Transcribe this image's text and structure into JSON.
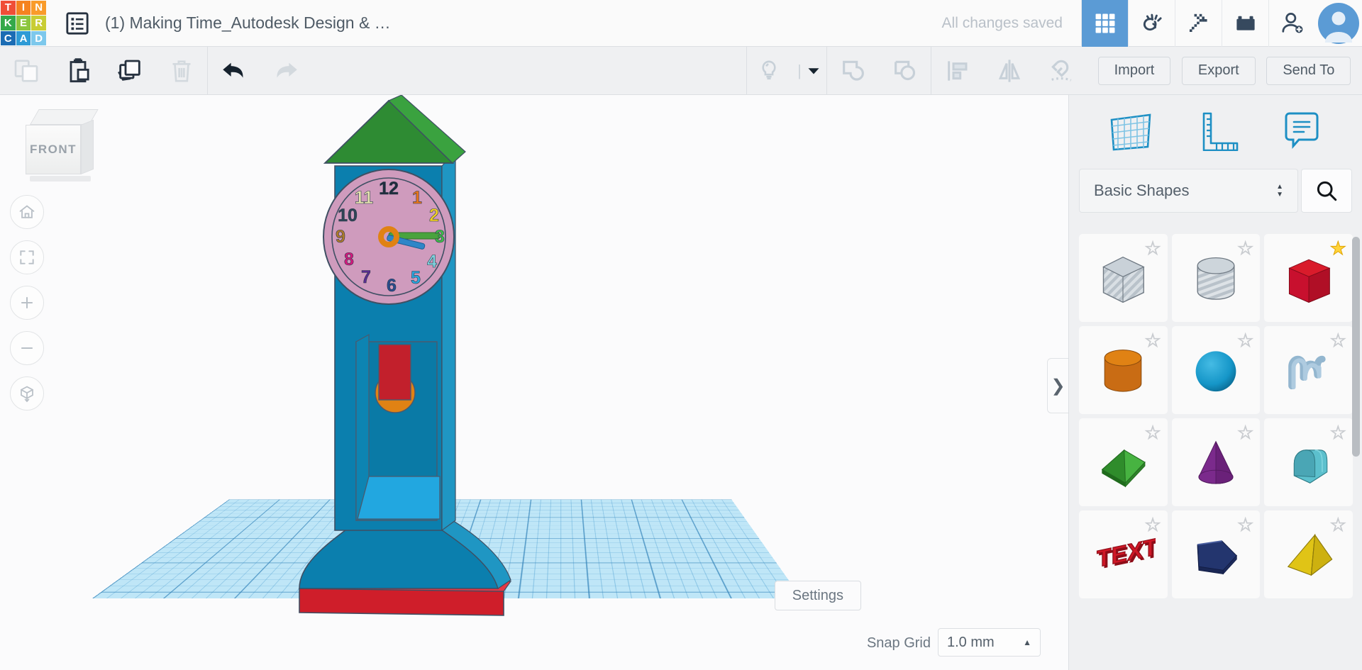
{
  "app": {
    "logo_tiles": [
      {
        "letter": "T",
        "color": "#f04e37"
      },
      {
        "letter": "I",
        "color": "#f58220"
      },
      {
        "letter": "N",
        "color": "#f99b2a"
      },
      {
        "letter": "K",
        "color": "#34a94a"
      },
      {
        "letter": "E",
        "color": "#8cc63e"
      },
      {
        "letter": "R",
        "color": "#c8cd34"
      },
      {
        "letter": "C",
        "color": "#1b6cb4"
      },
      {
        "letter": "A",
        "color": "#2e9bd6"
      },
      {
        "letter": "D",
        "color": "#7dc8ec"
      }
    ]
  },
  "header": {
    "panel_toggle_icon": "list-panel-icon",
    "title": "(1) Making Time_Autodesk Design & …",
    "save_status": "All changes saved",
    "icons": [
      {
        "name": "blocks-grid-icon",
        "active": true
      },
      {
        "name": "tinker-hand-icon",
        "active": false
      },
      {
        "name": "pickaxe-minecraft-icon",
        "active": false
      },
      {
        "name": "lego-brick-icon",
        "active": false
      },
      {
        "name": "add-person-icon",
        "active": false
      }
    ],
    "avatar_icon": "user-avatar"
  },
  "toolbar": {
    "left_tools": [
      {
        "name": "copy-button",
        "enabled": false
      },
      {
        "name": "paste-button",
        "enabled": true
      },
      {
        "name": "duplicate-button",
        "enabled": true
      },
      {
        "name": "delete-button",
        "enabled": false
      },
      {
        "name": "undo-button",
        "enabled": true
      },
      {
        "name": "redo-button",
        "enabled": false
      }
    ],
    "mid_tools": [
      {
        "name": "light-bulb-button",
        "enabled": false
      },
      {
        "name": "light-dropdown-caret",
        "enabled": true
      },
      {
        "name": "group-button",
        "enabled": false
      },
      {
        "name": "ungroup-button",
        "enabled": false
      },
      {
        "name": "align-button",
        "enabled": false
      },
      {
        "name": "mirror-button",
        "enabled": false
      },
      {
        "name": "workplane-magnet-button",
        "enabled": false
      }
    ],
    "import_label": "Import",
    "export_label": "Export",
    "send_to_label": "Send To"
  },
  "canvas": {
    "view_cube_label": "FRONT",
    "view_buttons": [
      {
        "name": "home-view-button",
        "icon": "home-icon"
      },
      {
        "name": "fit-view-button",
        "icon": "fit-frame-icon"
      },
      {
        "name": "zoom-in-button",
        "icon": "plus-icon"
      },
      {
        "name": "zoom-out-button",
        "icon": "minus-icon"
      },
      {
        "name": "perspective-toggle-button",
        "icon": "ortho-cube-icon"
      }
    ],
    "settings_label": "Settings",
    "snap_grid_label": "Snap Grid",
    "snap_grid_value": "1.0 mm",
    "grid_color": "#bfe6f7",
    "grid_line_color": "#2d7db4"
  },
  "model": {
    "name": "clock-tower-model",
    "roof_color": "#2e8b33",
    "body_color": "#0b7fae",
    "base_stripe_color": "#cf1e2a",
    "clock_face_color": "#cf9bbd",
    "clock_rim_color": "#c08fb0",
    "minute_hand_color": "#49a33e",
    "hour_hand_color": "#2e86c8",
    "hand_hub_color": "#e08214",
    "pendulum_rod_color": "#c2202c",
    "pendulum_bob_color": "#e08214",
    "cavity_floor_color": "#22a7e0",
    "clock_numerals": [
      {
        "n": "12",
        "color": "#1f2d3d"
      },
      {
        "n": "1",
        "color": "#e8751a"
      },
      {
        "n": "2",
        "color": "#f2d024"
      },
      {
        "n": "3",
        "color": "#3fbf4a"
      },
      {
        "n": "4",
        "color": "#7fd4df"
      },
      {
        "n": "5",
        "color": "#29a8e0"
      },
      {
        "n": "6",
        "color": "#2a4b8d"
      },
      {
        "n": "7",
        "color": "#5b2d91"
      },
      {
        "n": "8",
        "color": "#d6197f"
      },
      {
        "n": "9",
        "color": "#b07a2a"
      },
      {
        "n": "10",
        "color": "#2f4456"
      },
      {
        "n": "11",
        "color": "#e8e4b0"
      }
    ]
  },
  "right_panel": {
    "handle_icon": "chevron-right-icon",
    "tool_icons": [
      {
        "name": "workplane-icon"
      },
      {
        "name": "ruler-icon"
      },
      {
        "name": "note-icon"
      }
    ],
    "category_value": "Basic Shapes",
    "search_placeholder": "Search",
    "accent_color": "#1d8fc4",
    "shapes": [
      {
        "name": "shape-box-hole",
        "label": "Box (hole)",
        "favorite": false,
        "kind": "box",
        "color": "#cfd6dd",
        "striped": true
      },
      {
        "name": "shape-cylinder-hole",
        "label": "Cylinder (hole)",
        "favorite": false,
        "kind": "cylinder",
        "color": "#cfd6dd",
        "striped": true
      },
      {
        "name": "shape-box-red",
        "label": "Box",
        "favorite": true,
        "kind": "box",
        "color": "#c8102e",
        "striped": false
      },
      {
        "name": "shape-cylinder-orange",
        "label": "Cylinder",
        "favorite": false,
        "kind": "cylinder",
        "color": "#d9781c",
        "striped": false
      },
      {
        "name": "shape-sphere-blue",
        "label": "Sphere",
        "favorite": false,
        "kind": "sphere",
        "color": "#1596c8",
        "striped": false
      },
      {
        "name": "shape-scribble",
        "label": "Scribble",
        "favorite": false,
        "kind": "scribble",
        "color": "#93b6cf",
        "striped": false
      },
      {
        "name": "shape-wedge-green",
        "label": "Wedge",
        "favorite": false,
        "kind": "wedge",
        "color": "#3a9e35",
        "striped": false
      },
      {
        "name": "shape-cone-purple",
        "label": "Cone",
        "favorite": false,
        "kind": "cone",
        "color": "#7b2a8c",
        "striped": false
      },
      {
        "name": "shape-roof-teal",
        "label": "Round Roof",
        "favorite": false,
        "kind": "roof",
        "color": "#4aa6b5",
        "striped": false
      },
      {
        "name": "shape-text-red",
        "label": "Text",
        "favorite": false,
        "kind": "text",
        "color": "#cf1726",
        "striped": false
      },
      {
        "name": "shape-polygon-navy",
        "label": "Polygon",
        "favorite": false,
        "kind": "polygon",
        "color": "#23356e",
        "striped": false
      },
      {
        "name": "shape-pyramid-yellow",
        "label": "Pyramid",
        "favorite": false,
        "kind": "pyramid",
        "color": "#e0c416",
        "striped": false
      }
    ]
  }
}
